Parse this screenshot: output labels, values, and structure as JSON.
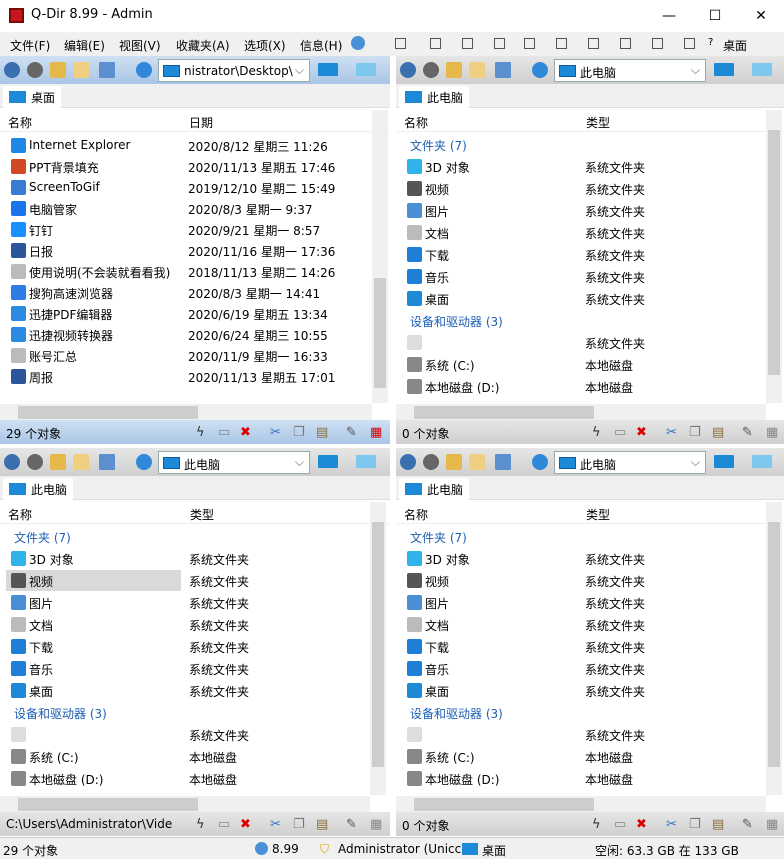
{
  "window": {
    "title": "Q-Dir 8.99 - Admin",
    "minimize": "—",
    "maximize": "☐",
    "close": "✕"
  },
  "menu": [
    "文件(F)",
    "编辑(E)",
    "视图(V)",
    "收藏夹(A)",
    "选项(X)",
    "信息(H)"
  ],
  "menu_right": {
    "inet": "?",
    "desktop": "桌面"
  },
  "panes": [
    {
      "address": "nistrator\\Desktop\\",
      "tab": "桌面",
      "columns": [
        "名称",
        "日期"
      ],
      "active": true,
      "rows": [
        {
          "name": "Internet  Explorer",
          "col2": "2020/8/12 星期三 11:26",
          "color": "#1e88e5"
        },
        {
          "name": "PPT背景填充",
          "col2": "2020/11/13 星期五 17:46",
          "color": "#d24726"
        },
        {
          "name": "ScreenToGif",
          "col2": "2019/12/10 星期二 15:49",
          "color": "#3a7bd5"
        },
        {
          "name": "电脑管家",
          "col2": "2020/8/3 星期一 9:37",
          "color": "#1a73e8"
        },
        {
          "name": "钉钉",
          "col2": "2020/9/21 星期一 8:57",
          "color": "#1890ff"
        },
        {
          "name": "日报",
          "col2": "2020/11/16 星期一 17:36",
          "color": "#2b579a"
        },
        {
          "name": "使用说明(不会装就看看我)",
          "col2": "2018/11/13 星期二 14:26",
          "color": "#bbbbbb"
        },
        {
          "name": "搜狗高速浏览器",
          "col2": "2020/8/3 星期一 14:41",
          "color": "#2d7be5"
        },
        {
          "name": "迅捷PDF编辑器",
          "col2": "2020/6/19 星期五 13:34",
          "color": "#2b8ae2"
        },
        {
          "name": "迅捷视频转换器",
          "col2": "2020/6/24 星期三 10:55",
          "color": "#2b8ae2"
        },
        {
          "name": "账号汇总",
          "col2": "2020/11/9 星期一 16:33",
          "color": "#bbbbbb"
        },
        {
          "name": "周报",
          "col2": "2020/11/13 星期五 17:01",
          "color": "#2b579a"
        }
      ],
      "status": "29 个对象"
    },
    {
      "address": "此电脑",
      "tab": "此电脑",
      "columns": [
        "名称",
        "类型"
      ],
      "active": false,
      "rows": "pc",
      "status": "0 个对象"
    },
    {
      "address": "此电脑",
      "tab": "此电脑",
      "columns": [
        "名称",
        "类型"
      ],
      "active": false,
      "rows": "pc",
      "status": "C:\\Users\\Administrator\\Vide",
      "selected": 2
    },
    {
      "address": "此电脑",
      "tab": "此电脑",
      "columns": [
        "名称",
        "类型"
      ],
      "active": false,
      "rows": "pc",
      "status": "0 个对象"
    }
  ],
  "pc_rows": [
    {
      "section": "文件夹 (7)"
    },
    {
      "name": "3D 对象",
      "col2": "系统文件夹",
      "color": "#2fb3e8"
    },
    {
      "name": "视频",
      "col2": "系统文件夹",
      "color": "#555"
    },
    {
      "name": "图片",
      "col2": "系统文件夹",
      "color": "#4a8fd6"
    },
    {
      "name": "文档",
      "col2": "系统文件夹",
      "color": "#bbbbbb"
    },
    {
      "name": "下载",
      "col2": "系统文件夹",
      "color": "#1e7fd8"
    },
    {
      "name": "音乐",
      "col2": "系统文件夹",
      "color": "#1e7fd8"
    },
    {
      "name": "桌面",
      "col2": "系统文件夹",
      "color": "#1d8ad8"
    },
    {
      "section": "设备和驱动器 (3)"
    },
    {
      "name": "",
      "col2": "系统文件夹",
      "color": "#dddddd"
    },
    {
      "name": "系统 (C:)",
      "col2": "本地磁盘",
      "color": "#888"
    },
    {
      "name": "本地磁盘 (D:)",
      "col2": "本地磁盘",
      "color": "#888"
    }
  ],
  "statusbar": {
    "count": "29 个对象",
    "version": "8.99",
    "user": "Administrator (Unicc",
    "location": "桌面",
    "free": "空闲: 63.3 GB 在 133 GB"
  }
}
